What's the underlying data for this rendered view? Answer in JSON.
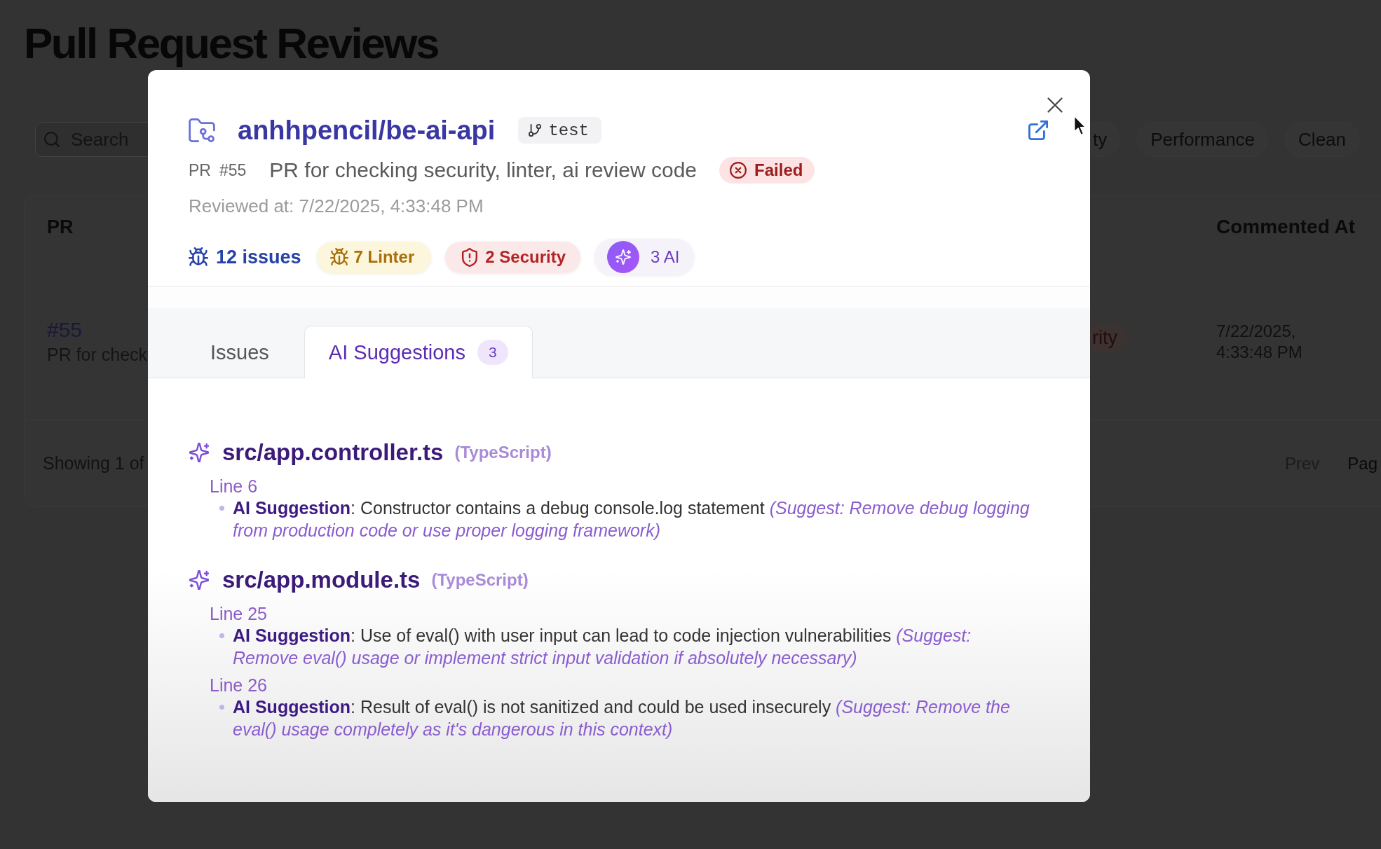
{
  "background_page": {
    "title": "Pull Request Reviews",
    "search": {
      "placeholder": "Search"
    },
    "filters": [
      {
        "label": "ty",
        "selected": false
      },
      {
        "label": "Performance",
        "selected": false
      },
      {
        "label": "Clean",
        "selected": false
      }
    ],
    "table": {
      "columns": [
        {
          "label": "PR"
        },
        {
          "label": "Commented At"
        }
      ],
      "rows": [
        {
          "number": "#55",
          "title": "PR for check",
          "badge": "rity",
          "commented_at": "7/22/2025, 4:33:48 PM"
        }
      ],
      "footer": {
        "summary": "Showing 1 of",
        "prev": {
          "label": "Prev",
          "disabled": true
        },
        "page": "Pag"
      }
    }
  },
  "modal": {
    "repo": "anhhpencil/be-ai-api",
    "branch": "test",
    "pr_label": "PR",
    "pr_number": "#55",
    "pr_title": "PR for checking security, linter, ai review code",
    "status": {
      "kind": "failed",
      "label": "Failed"
    },
    "reviewed_at": "Reviewed at: 7/22/2025, 4:33:48 PM",
    "stats": [
      {
        "kind": "total",
        "label": "12 issues"
      },
      {
        "kind": "linter",
        "label": "7 Linter"
      },
      {
        "kind": "security",
        "label": "2 Security"
      },
      {
        "kind": "ai",
        "label": "3 AI"
      }
    ],
    "tabs": [
      {
        "label": "Issues",
        "selected": false
      },
      {
        "label": "AI Suggestions",
        "count": "3",
        "selected": true
      }
    ],
    "files": [
      {
        "path": "src/app.controller.ts",
        "language": "(TypeScript)",
        "lines": [
          {
            "label": "Line 6",
            "suggestions": [
              "**AI Suggestion**: Constructor contains a debug console.log statement *(Suggest: Remove debug logging from production code or use proper logging framework)*"
            ]
          }
        ]
      },
      {
        "path": "src/app.module.ts",
        "language": "(TypeScript)",
        "lines": [
          {
            "label": "Line 25",
            "suggestions": [
              "**AI Suggestion**: Use of eval() with user input can lead to code injection vulnerabilities *(Suggest: Remove eval() usage or implement strict input validation if absolutely necessary)*"
            ]
          },
          {
            "label": "Line 26",
            "suggestions": [
              "**AI Suggestion**: Result of eval() is not sanitized and could be used insecurely *(Suggest: Remove the eval() usage completely as it's dangerous in this context)*"
            ]
          }
        ]
      }
    ]
  }
}
